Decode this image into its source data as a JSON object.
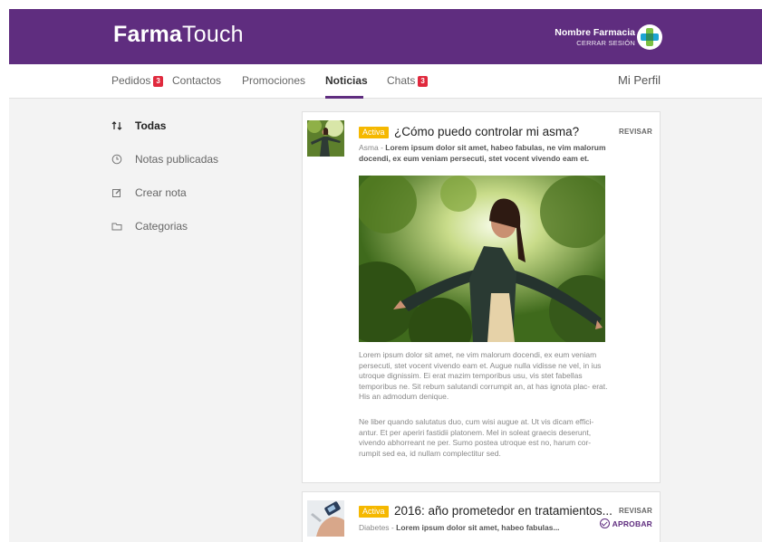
{
  "brand": {
    "bold": "Farma",
    "light": "Touch"
  },
  "pharmacy": {
    "name": "Nombre Farmacia",
    "logout": "CERRAR SESIÓN",
    "logo_icon": "pharmacy-cross-icon"
  },
  "nav": {
    "items": [
      {
        "label": "Pedidos",
        "badge": "3"
      },
      {
        "label": "Contactos"
      },
      {
        "label": "Promociones"
      },
      {
        "label": "Noticias",
        "active": true
      },
      {
        "label": "Chats",
        "badge": "3"
      }
    ],
    "profile": "Mi Perfil"
  },
  "sidebar": {
    "items": [
      {
        "label": "Todas",
        "icon": "sort-arrows-icon",
        "active": true
      },
      {
        "label": "Notas publicadas",
        "icon": "clock-icon"
      },
      {
        "label": "Crear nota",
        "icon": "edit-icon"
      },
      {
        "label": "Categorias",
        "icon": "folder-icon"
      }
    ]
  },
  "posts": [
    {
      "status": "Activa",
      "title": "¿Cómo puedo controlar mi asma?",
      "category": "Asma",
      "excerpt": "Lorem ipsum dolor sit amet, habeo fabulas, ne vim malorum docendi, ex eum veniam persecuti, stet vocent vivendo eam et.",
      "review": "REVISAR",
      "paragraphs": [
        "Lorem ipsum dolor sit amet, ne vim malorum docendi, ex eum veniam persecuti, stet vocent vivendo eam et. Augue nulla vidisse ne vel, in ius utroque dignissim. Ei erat mazim temporibus usu, vis stet fabellas temporibus ne. Sit rebum salutandi corrumpit an, at has ignota plac- erat. His an admodum denique.",
        "Ne liber quando salutatus duo, cum wisi augue at. Ut vis dicam effici- antur. Et per aperiri fastidii platonem. Mel in soleat graecis deserunt, vivendo abhorreant ne per. Sumo postea utroque est no, harum cor- rumpit sed ea, id nullam complectitur sed."
      ]
    },
    {
      "status": "Activa",
      "title": "2016: año prometedor en tratamientos...",
      "category": "Diabetes",
      "excerpt": "Lorem ipsum dolor sit amet, habeo fabulas...",
      "review": "REVISAR",
      "approve": "APROBAR"
    }
  ],
  "colors": {
    "brand_purple": "#5f2d7f",
    "badge_red": "#e0293d",
    "status_yellow": "#f5b800"
  }
}
